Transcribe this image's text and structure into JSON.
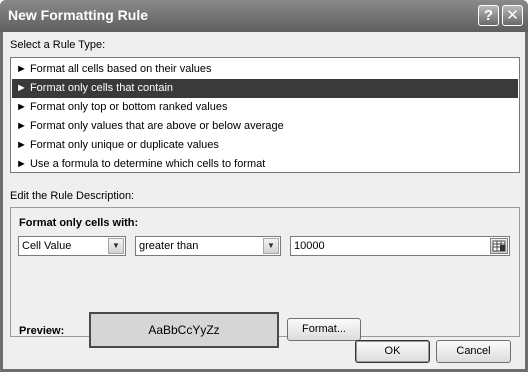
{
  "dialog": {
    "title": "New Formatting Rule",
    "help_label": "?",
    "close_label": "✕"
  },
  "rule_type": {
    "heading": "Select a Rule Type:",
    "arrow": "►",
    "items": [
      {
        "label": "Format all cells based on their values"
      },
      {
        "label": "Format only cells that contain"
      },
      {
        "label": "Format only top or bottom ranked values"
      },
      {
        "label": "Format only values that are above or below average"
      },
      {
        "label": "Format only unique or duplicate values"
      },
      {
        "label": "Use a formula to determine which cells to format"
      }
    ],
    "selected_index": 1
  },
  "description": {
    "heading": "Edit the Rule Description:",
    "format_heading": "Format only cells with:",
    "condition_type": "Cell Value",
    "operator": "greater than",
    "value": "10000",
    "preview_label": "Preview:",
    "preview_sample": "AaBbCcYyZz",
    "format_button": "Format..."
  },
  "footer": {
    "ok": "OK",
    "cancel": "Cancel"
  }
}
